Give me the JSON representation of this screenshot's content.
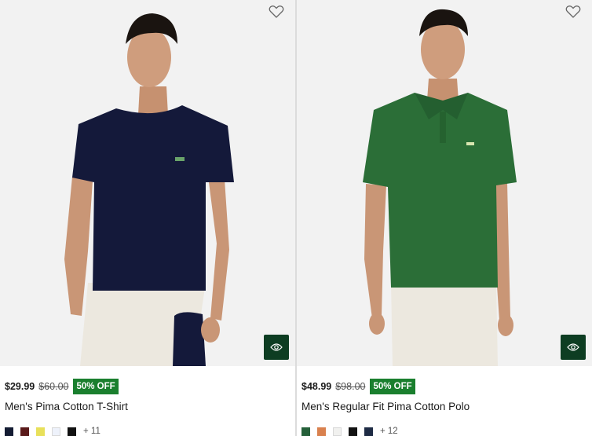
{
  "products": [
    {
      "price": "$29.99",
      "old_price": "$60.00",
      "discount": "50% OFF",
      "name": "Men's Pima Cotton T-Shirt",
      "more_colors": "+ 11",
      "shirt_color": "#14193a",
      "swatches": [
        "#141c33",
        "#5a1a1a",
        "#e8e05a",
        "#eef2fb",
        "#111111"
      ],
      "selected_swatch": 0
    },
    {
      "price": "$48.99",
      "old_price": "$98.00",
      "discount": "50% OFF",
      "name": "Men's Regular Fit Pima Cotton Polo",
      "more_colors": "+ 12",
      "shirt_color": "#2b6e37",
      "swatches": [
        "#25603a",
        "#d9814e",
        "#f1f1ef",
        "#121212",
        "#1e2b44"
      ],
      "selected_swatch": 0
    }
  ],
  "icons": {
    "wishlist": "heart-outline-icon",
    "quick_view": "eye-icon"
  },
  "colors": {
    "badge": "#1a7f2e",
    "quick_view_bg": "#0d3d22"
  }
}
